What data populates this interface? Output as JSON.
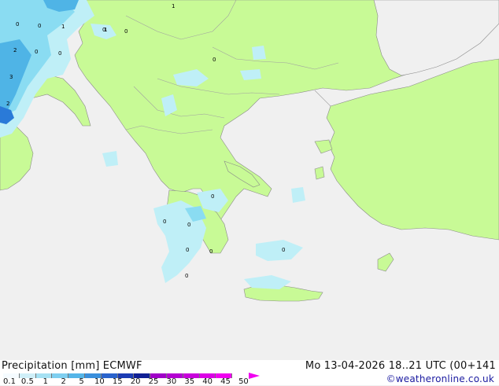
{
  "map": {
    "colors": {
      "sea": "#f0f0f0",
      "land": "#c8fa96",
      "land_outside_model": "#f0f0f0",
      "coast": "#8a8a8a",
      "border": "#a0a0a0",
      "precip_light": "#bfeff7",
      "precip_medium": "#8adcf2",
      "precip_heavy": "#4fb4e6",
      "precip_strong": "#2a7ad8"
    },
    "point_labels": [
      "1",
      "0",
      "0",
      "1",
      "0",
      "1",
      "0",
      "2",
      "0",
      "0",
      "3",
      "2",
      "0",
      "0",
      "0",
      "0",
      "0",
      "0",
      "0",
      "0"
    ]
  },
  "footer": {
    "title": "Precipitation [mm]  ECMWF",
    "datetime": "Mo 13-04-2026 18..21 UTC (00+141",
    "credit": "©weatheronline.co.uk",
    "scale_ticks": [
      "0.1",
      "0.5",
      "1",
      "2",
      "5",
      "10",
      "15",
      "20",
      "25",
      "30",
      "35",
      "40",
      "45",
      "50"
    ],
    "scale_colors": [
      "#f5fbff",
      "#cfeff8",
      "#a6e1f3",
      "#7fcff0",
      "#55b5e8",
      "#3a8fdc",
      "#2a63cc",
      "#1c3cb4",
      "#102094",
      "#a000c8",
      "#b400d2",
      "#c800dc",
      "#dc00e6",
      "#f000f0"
    ]
  }
}
